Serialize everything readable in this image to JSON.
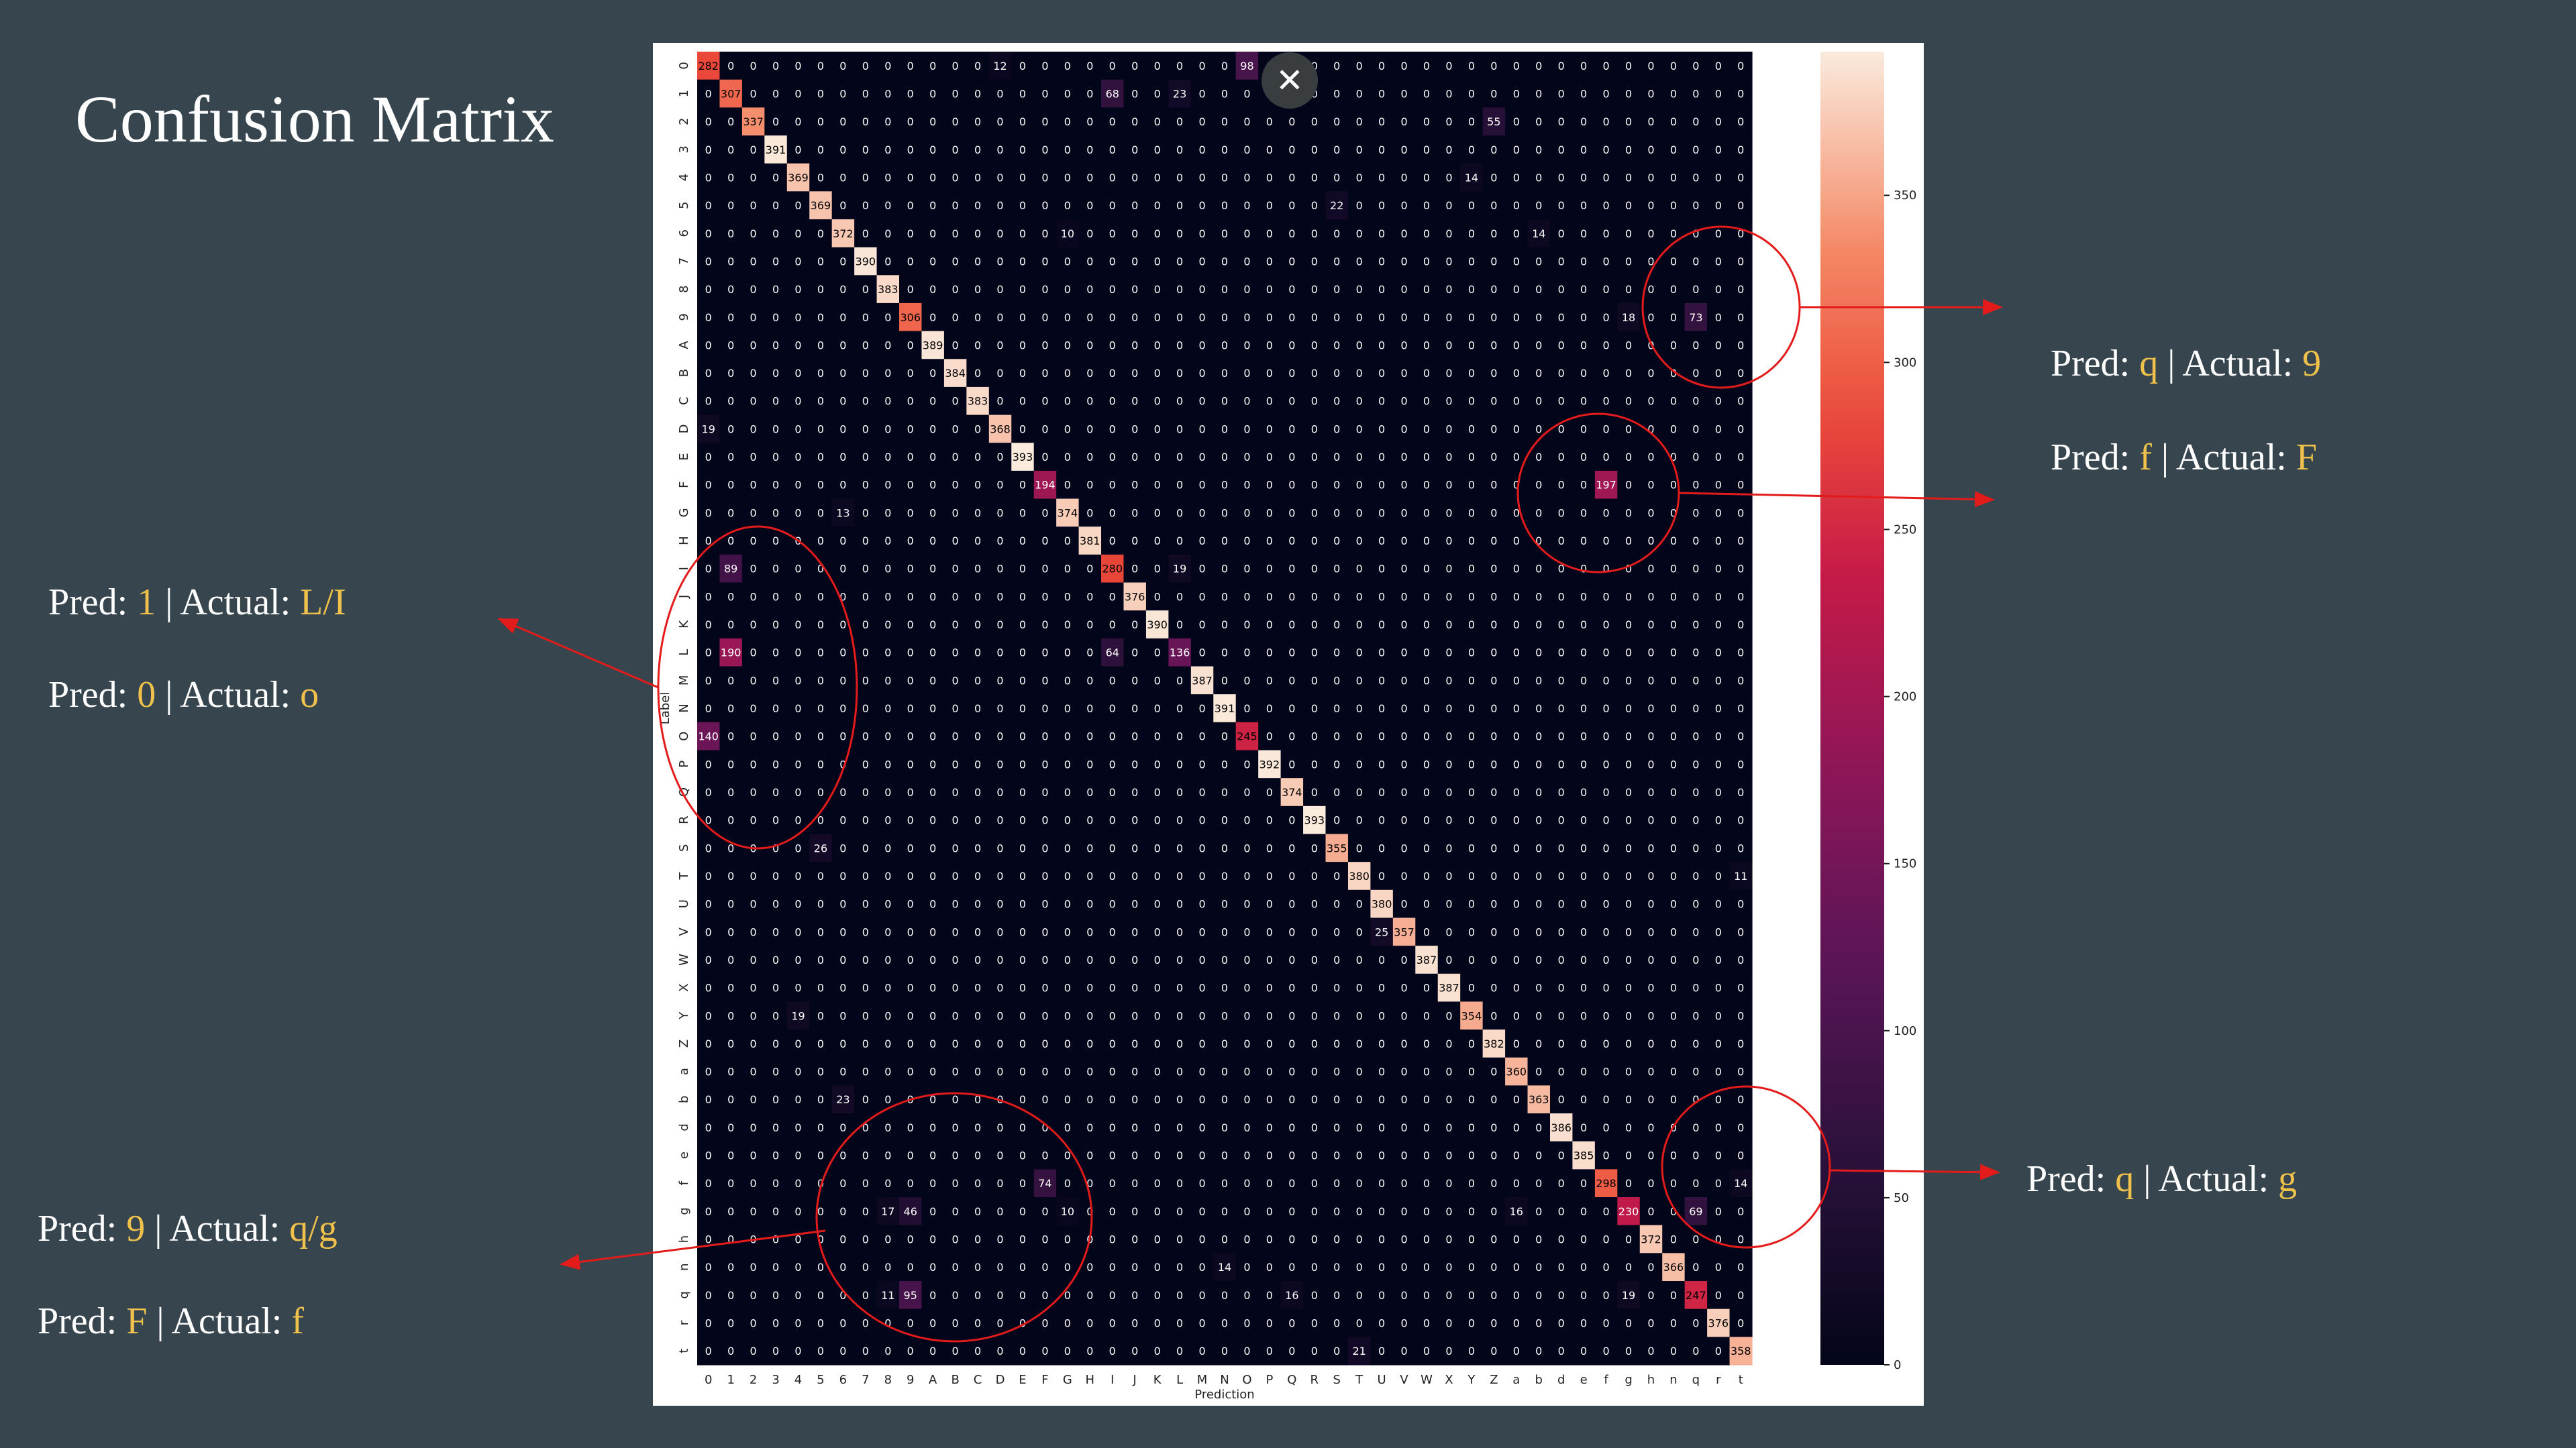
{
  "slide": {
    "title": "Confusion Matrix",
    "close_icon": "close-icon",
    "accent_color": "#f0c24b",
    "marker_color": "#e31b1b"
  },
  "annotations": [
    {
      "pred_label": "Pred:",
      "pred": "q",
      "actual_label": "| Actual:",
      "actual": "9"
    },
    {
      "pred_label": "Pred:",
      "pred": "f",
      "actual_label": "| Actual:",
      "actual": "F"
    },
    {
      "pred_label": "Pred:",
      "pred": "1",
      "actual_label": "| Actual:",
      "actual": "L/I"
    },
    {
      "pred_label": "Pred:",
      "pred": "0",
      "actual_label": "| Actual:",
      "actual": "o"
    },
    {
      "pred_label": "Pred:",
      "pred": "q",
      "actual_label": "| Actual:",
      "actual": "g"
    },
    {
      "pred_label": "Pred:",
      "pred": "9",
      "actual_label": "| Actual:",
      "actual": "q/g"
    },
    {
      "pred_label": "Pred:",
      "pred": "F",
      "actual_label": "| Actual:",
      "actual": "f"
    }
  ],
  "chart_data": {
    "type": "heatmap",
    "title": "",
    "xlabel": "Prediction",
    "ylabel": "Label",
    "labels": [
      "0",
      "1",
      "2",
      "3",
      "4",
      "5",
      "6",
      "7",
      "8",
      "9",
      "A",
      "B",
      "C",
      "D",
      "E",
      "F",
      "G",
      "H",
      "I",
      "J",
      "K",
      "L",
      "M",
      "N",
      "O",
      "P",
      "Q",
      "R",
      "S",
      "T",
      "U",
      "V",
      "W",
      "X",
      "Y",
      "Z",
      "a",
      "b",
      "d",
      "e",
      "f",
      "g",
      "h",
      "n",
      "q",
      "r",
      "t"
    ],
    "colormap": "rocket",
    "color_range": [
      0,
      393
    ],
    "colorbar_ticks": [
      0,
      50,
      100,
      150,
      200,
      250,
      300,
      350
    ],
    "diagonal": [
      282,
      307,
      337,
      391,
      369,
      369,
      372,
      390,
      383,
      306,
      389,
      384,
      383,
      368,
      393,
      194,
      374,
      381,
      280,
      376,
      390,
      136,
      387,
      391,
      245,
      392,
      374,
      393,
      355,
      380,
      380,
      357,
      387,
      387,
      354,
      382,
      360,
      363,
      386,
      385,
      298,
      230,
      372,
      366,
      247,
      376,
      358
    ],
    "off_diagonal": [
      {
        "row": "0",
        "col": "O",
        "value": 98
      },
      {
        "row": "0",
        "col": "D",
        "value": 12
      },
      {
        "row": "1",
        "col": "I",
        "value": 68
      },
      {
        "row": "1",
        "col": "L",
        "value": 23
      },
      {
        "row": "2",
        "col": "Z",
        "value": 55
      },
      {
        "row": "4",
        "col": "Y",
        "value": 14
      },
      {
        "row": "5",
        "col": "S",
        "value": 22
      },
      {
        "row": "6",
        "col": "b",
        "value": 14
      },
      {
        "row": "6",
        "col": "G",
        "value": 10
      },
      {
        "row": "9",
        "col": "g",
        "value": 18
      },
      {
        "row": "9",
        "col": "q",
        "value": 73
      },
      {
        "row": "D",
        "col": "0",
        "value": 19
      },
      {
        "row": "F",
        "col": "f",
        "value": 197
      },
      {
        "row": "G",
        "col": "6",
        "value": 13
      },
      {
        "row": "I",
        "col": "1",
        "value": 89
      },
      {
        "row": "I",
        "col": "L",
        "value": 19
      },
      {
        "row": "L",
        "col": "1",
        "value": 190
      },
      {
        "row": "L",
        "col": "I",
        "value": 64
      },
      {
        "row": "O",
        "col": "0",
        "value": 140
      },
      {
        "row": "S",
        "col": "5",
        "value": 26
      },
      {
        "row": "T",
        "col": "t",
        "value": 11
      },
      {
        "row": "V",
        "col": "U",
        "value": 25
      },
      {
        "row": "Y",
        "col": "4",
        "value": 19
      },
      {
        "row": "b",
        "col": "6",
        "value": 23
      },
      {
        "row": "f",
        "col": "F",
        "value": 74
      },
      {
        "row": "f",
        "col": "t",
        "value": 14
      },
      {
        "row": "g",
        "col": "8",
        "value": 17
      },
      {
        "row": "g",
        "col": "9",
        "value": 46
      },
      {
        "row": "g",
        "col": "a",
        "value": 16
      },
      {
        "row": "g",
        "col": "q",
        "value": 69
      },
      {
        "row": "g",
        "col": "G",
        "value": 10
      },
      {
        "row": "n",
        "col": "N",
        "value": 14
      },
      {
        "row": "q",
        "col": "9",
        "value": 95
      },
      {
        "row": "q",
        "col": "8",
        "value": 11
      },
      {
        "row": "q",
        "col": "g",
        "value": 19
      },
      {
        "row": "q",
        "col": "Q",
        "value": 16
      },
      {
        "row": "t",
        "col": "T",
        "value": 21
      }
    ]
  }
}
